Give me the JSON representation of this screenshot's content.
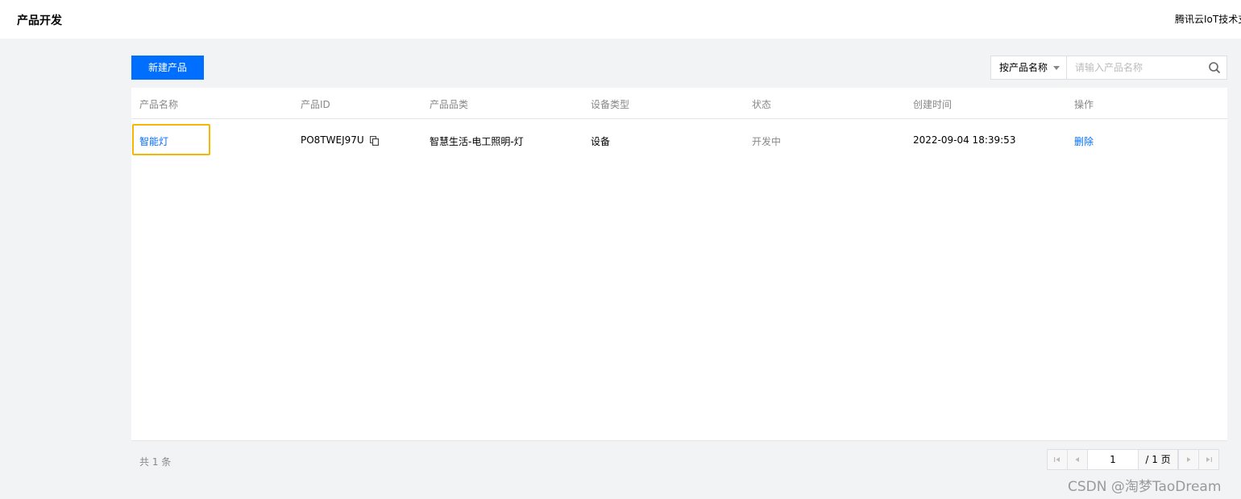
{
  "header": {
    "title": "产品开发",
    "right_link": "腾讯云IoT技术支"
  },
  "toolbar": {
    "new_product_label": "新建产品",
    "search_by_label": "按产品名称",
    "search_placeholder": "请输入产品名称"
  },
  "table": {
    "columns": [
      "产品名称",
      "产品ID",
      "产品品类",
      "设备类型",
      "状态",
      "创建时间",
      "操作"
    ],
    "rows": [
      {
        "name": "智能灯",
        "id": "PO8TWEJ97U",
        "category": "智慧生活-电工照明-灯",
        "device_type": "设备",
        "status": "开发中",
        "created": "2022-09-04 18:39:53",
        "action": "删除"
      }
    ]
  },
  "footer": {
    "total_text": "共 1 条"
  },
  "pagination": {
    "current_page": "1",
    "total_text": "/ 1 页"
  },
  "watermark": "CSDN @淘梦TaoDream",
  "colors": {
    "primary": "#006eff",
    "highlight": "#f5b700",
    "background": "#f2f3f5"
  }
}
